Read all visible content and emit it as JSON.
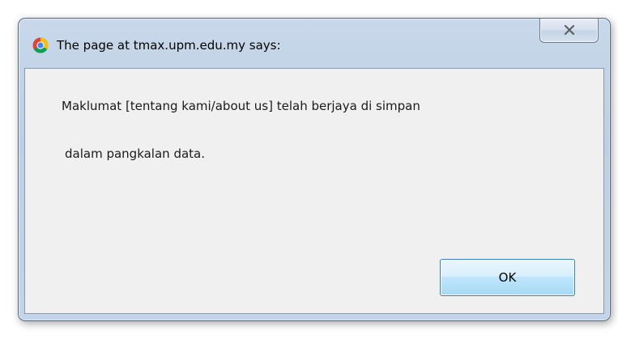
{
  "dialog": {
    "title": "The page at tmax.upm.edu.my says:",
    "message_line_1": "Maklumat [tentang kami/about us] telah berjaya di simpan",
    "message_line_2": "dalam pangkalan data.",
    "ok_label": "OK"
  },
  "icons": {
    "title_icon": "chrome-logo-icon",
    "close_icon": "close-x-icon"
  },
  "colors": {
    "frame": "#bccfe6",
    "client_background": "#f0f0f0",
    "ok_button_border": "#3c7fb1",
    "chrome_red": "#db4437",
    "chrome_yellow": "#f4c20d",
    "chrome_green": "#0f9d58",
    "chrome_blue": "#4285f4"
  }
}
